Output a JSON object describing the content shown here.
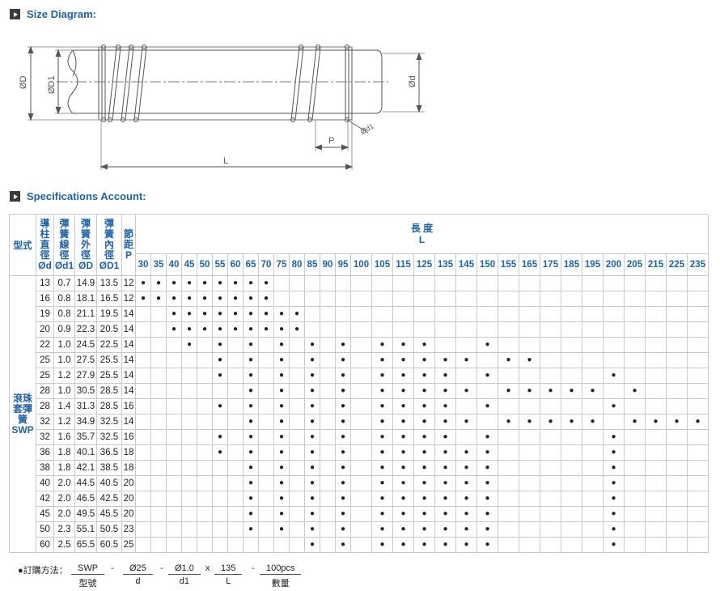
{
  "sections": {
    "size_diagram": "Size Diagram:",
    "specifications": "Specifications Account:"
  },
  "diagram_labels": {
    "D": "ØD",
    "D1": "ØD1",
    "d": "Ød",
    "d1": "Ød1",
    "P": "P",
    "L": "L"
  },
  "table": {
    "type_header": "型式",
    "col_headers": [
      [
        "導",
        "柱",
        "直",
        "徑",
        "Ød"
      ],
      [
        "彈",
        "簧",
        "線",
        "徑",
        "Ød1"
      ],
      [
        "彈",
        "簧",
        "外",
        "徑",
        "ØD"
      ],
      [
        "彈",
        "簧",
        "內",
        "徑",
        "ØD1"
      ],
      [
        "節",
        "距",
        "P"
      ]
    ],
    "length_header": "長 度",
    "length_sub": "L",
    "lengths": [
      "30",
      "35",
      "40",
      "45",
      "50",
      "55",
      "60",
      "65",
      "70",
      "75",
      "80",
      "85",
      "90",
      "95",
      "100",
      "105",
      "115",
      "125",
      "135",
      "145",
      "150",
      "155",
      "165",
      "175",
      "185",
      "195",
      "200",
      "205",
      "215",
      "225",
      "235"
    ],
    "type_label": [
      "滾珠",
      "套彈",
      "簧",
      "SWP"
    ],
    "dot_char": "●",
    "rows": [
      {
        "d": "13",
        "d1": "0.7",
        "D": "14.9",
        "D1": "13.5",
        "P": "12",
        "lens": [
          "30",
          "35",
          "40",
          "45",
          "50",
          "55",
          "60",
          "65",
          "70"
        ]
      },
      {
        "d": "16",
        "d1": "0.8",
        "D": "18.1",
        "D1": "16.5",
        "P": "12",
        "lens": [
          "30",
          "35",
          "40",
          "45",
          "50",
          "55",
          "60",
          "65",
          "70"
        ]
      },
      {
        "d": "19",
        "d1": "0.8",
        "D": "21.1",
        "D1": "19.5",
        "P": "14",
        "lens": [
          "40",
          "45",
          "50",
          "55",
          "60",
          "65",
          "70",
          "75",
          "80"
        ]
      },
      {
        "d": "20",
        "d1": "0.9",
        "D": "22.3",
        "D1": "20.5",
        "P": "14",
        "lens": [
          "40",
          "45",
          "50",
          "55",
          "60",
          "65",
          "70",
          "75",
          "80"
        ]
      },
      {
        "d": "22",
        "d1": "1.0",
        "D": "24.5",
        "D1": "22.5",
        "P": "14",
        "lens": [
          "45",
          "55",
          "65",
          "75",
          "85",
          "95",
          "105",
          "115",
          "125",
          "150"
        ]
      },
      {
        "d": "25",
        "d1": "1.0",
        "D": "27.5",
        "D1": "25.5",
        "P": "14",
        "lens": [
          "55",
          "65",
          "75",
          "85",
          "95",
          "105",
          "115",
          "125",
          "135",
          "145",
          "155",
          "165"
        ]
      },
      {
        "d": "25",
        "d1": "1.2",
        "D": "27.9",
        "D1": "25.5",
        "P": "14",
        "lens": [
          "55",
          "65",
          "75",
          "85",
          "95",
          "105",
          "115",
          "125",
          "135",
          "150",
          "200"
        ]
      },
      {
        "d": "28",
        "d1": "1.0",
        "D": "30.5",
        "D1": "28.5",
        "P": "14",
        "lens": [
          "65",
          "75",
          "85",
          "95",
          "105",
          "115",
          "125",
          "135",
          "145",
          "155",
          "165",
          "175",
          "185",
          "195",
          "205"
        ]
      },
      {
        "d": "28",
        "d1": "1.4",
        "D": "31.3",
        "D1": "28.5",
        "P": "16",
        "lens": [
          "55",
          "65",
          "75",
          "85",
          "95",
          "105",
          "115",
          "125",
          "135",
          "150",
          "200"
        ]
      },
      {
        "d": "32",
        "d1": "1.2",
        "D": "34.9",
        "D1": "32.5",
        "P": "14",
        "lens": [
          "65",
          "75",
          "85",
          "95",
          "105",
          "115",
          "125",
          "135",
          "145",
          "155",
          "165",
          "175",
          "185",
          "195",
          "205",
          "215",
          "225",
          "235"
        ]
      },
      {
        "d": "32",
        "d1": "1.6",
        "D": "35.7",
        "D1": "32.5",
        "P": "16",
        "lens": [
          "55",
          "65",
          "75",
          "85",
          "95",
          "105",
          "115",
          "125",
          "135",
          "150",
          "200"
        ]
      },
      {
        "d": "36",
        "d1": "1.8",
        "D": "40.1",
        "D1": "36.5",
        "P": "18",
        "lens": [
          "55",
          "65",
          "75",
          "85",
          "95",
          "105",
          "115",
          "125",
          "135",
          "145",
          "150",
          "200"
        ]
      },
      {
        "d": "38",
        "d1": "1.8",
        "D": "42.1",
        "D1": "38.5",
        "P": "18",
        "lens": [
          "65",
          "75",
          "85",
          "95",
          "105",
          "115",
          "125",
          "135",
          "145",
          "150",
          "200"
        ]
      },
      {
        "d": "40",
        "d1": "2.0",
        "D": "44.5",
        "D1": "40.5",
        "P": "20",
        "lens": [
          "65",
          "75",
          "85",
          "95",
          "105",
          "115",
          "125",
          "135",
          "145",
          "150",
          "200"
        ]
      },
      {
        "d": "42",
        "d1": "2.0",
        "D": "46.5",
        "D1": "42.5",
        "P": "20",
        "lens": [
          "65",
          "75",
          "85",
          "95",
          "105",
          "115",
          "125",
          "135",
          "145",
          "150",
          "200"
        ]
      },
      {
        "d": "45",
        "d1": "2.0",
        "D": "49.5",
        "D1": "45.5",
        "P": "20",
        "lens": [
          "65",
          "75",
          "85",
          "95",
          "105",
          "115",
          "125",
          "135",
          "145",
          "150",
          "200"
        ]
      },
      {
        "d": "50",
        "d1": "2.3",
        "D": "55.1",
        "D1": "50.5",
        "P": "23",
        "lens": [
          "65",
          "75",
          "85",
          "95",
          "105",
          "115",
          "125",
          "135",
          "145",
          "150",
          "200"
        ]
      },
      {
        "d": "60",
        "d1": "2.5",
        "D": "65.5",
        "D1": "60.5",
        "P": "25",
        "lens": [
          "85",
          "95",
          "105",
          "115",
          "125",
          "135",
          "145",
          "150",
          "200"
        ]
      }
    ]
  },
  "order": {
    "lead": "●訂購方法：",
    "items": [
      {
        "value": "SWP",
        "key": "型號"
      },
      {
        "value": "Ø25",
        "key": "d"
      },
      {
        "value": "Ø1.0",
        "key": "d1"
      },
      {
        "value": "135",
        "key": "L"
      },
      {
        "value": "100pcs",
        "key": "數量"
      }
    ],
    "separators": [
      "-",
      "-",
      "x",
      "-"
    ]
  }
}
